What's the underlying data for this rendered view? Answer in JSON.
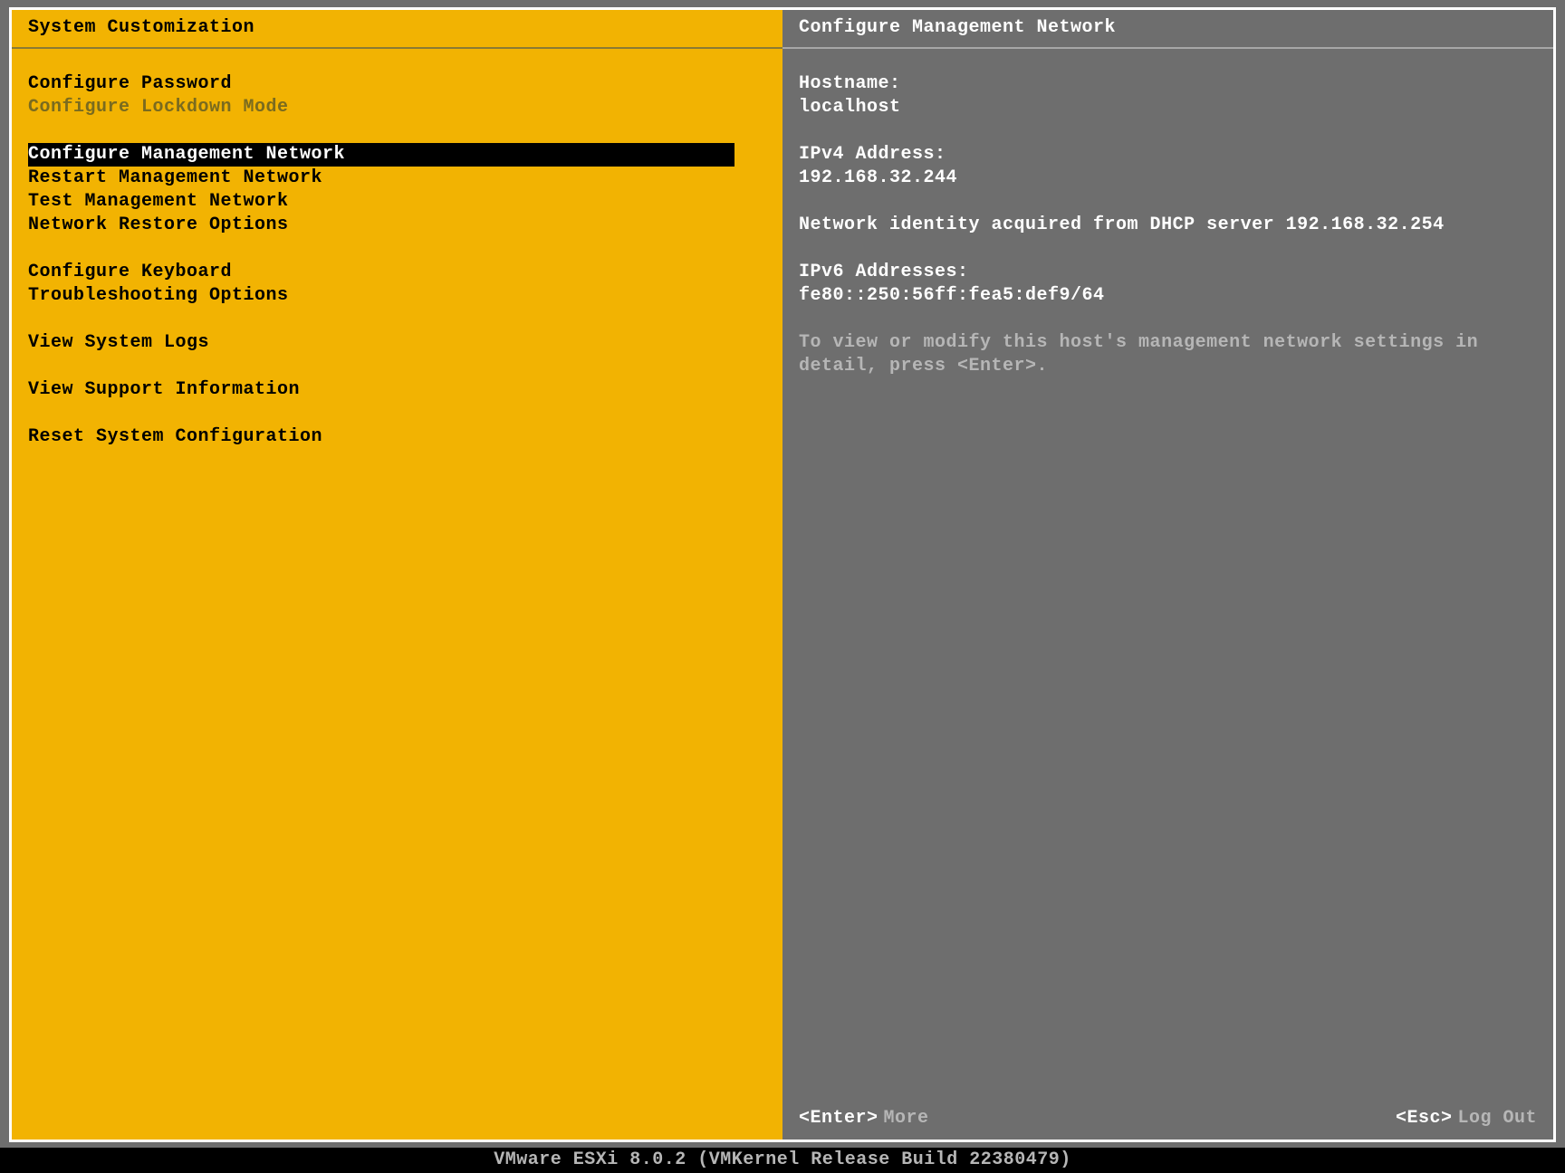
{
  "left": {
    "title": "System Customization",
    "groups": [
      [
        {
          "label": "Configure Password",
          "state": "normal"
        },
        {
          "label": "Configure Lockdown Mode",
          "state": "dimmed"
        }
      ],
      [
        {
          "label": "Configure Management Network",
          "state": "selected"
        },
        {
          "label": "Restart Management Network",
          "state": "normal"
        },
        {
          "label": "Test Management Network",
          "state": "normal"
        },
        {
          "label": "Network Restore Options",
          "state": "normal"
        }
      ],
      [
        {
          "label": "Configure Keyboard",
          "state": "normal"
        },
        {
          "label": "Troubleshooting Options",
          "state": "normal"
        }
      ],
      [
        {
          "label": "View System Logs",
          "state": "normal"
        }
      ],
      [
        {
          "label": "View Support Information",
          "state": "normal"
        }
      ],
      [
        {
          "label": "Reset System Configuration",
          "state": "normal"
        }
      ]
    ]
  },
  "right": {
    "title": "Configure Management Network",
    "hostname_label": "Hostname:",
    "hostname_value": "localhost",
    "ipv4_label": "IPv4 Address:",
    "ipv4_value": "192.168.32.244",
    "dhcp_line": "Network identity acquired from DHCP server 192.168.32.254",
    "ipv6_label": "IPv6 Addresses:",
    "ipv6_value": "fe80::250:56ff:fea5:def9/64",
    "hint_line1": "To view or modify this host's management network settings in",
    "hint_line2": "detail, press <Enter>.",
    "footer_left_key": "<Enter>",
    "footer_left_action": "More",
    "footer_right_key": "<Esc>",
    "footer_right_action": "Log Out"
  },
  "status_bar": "VMware ESXi 8.0.2 (VMKernel Release Build 22380479)"
}
